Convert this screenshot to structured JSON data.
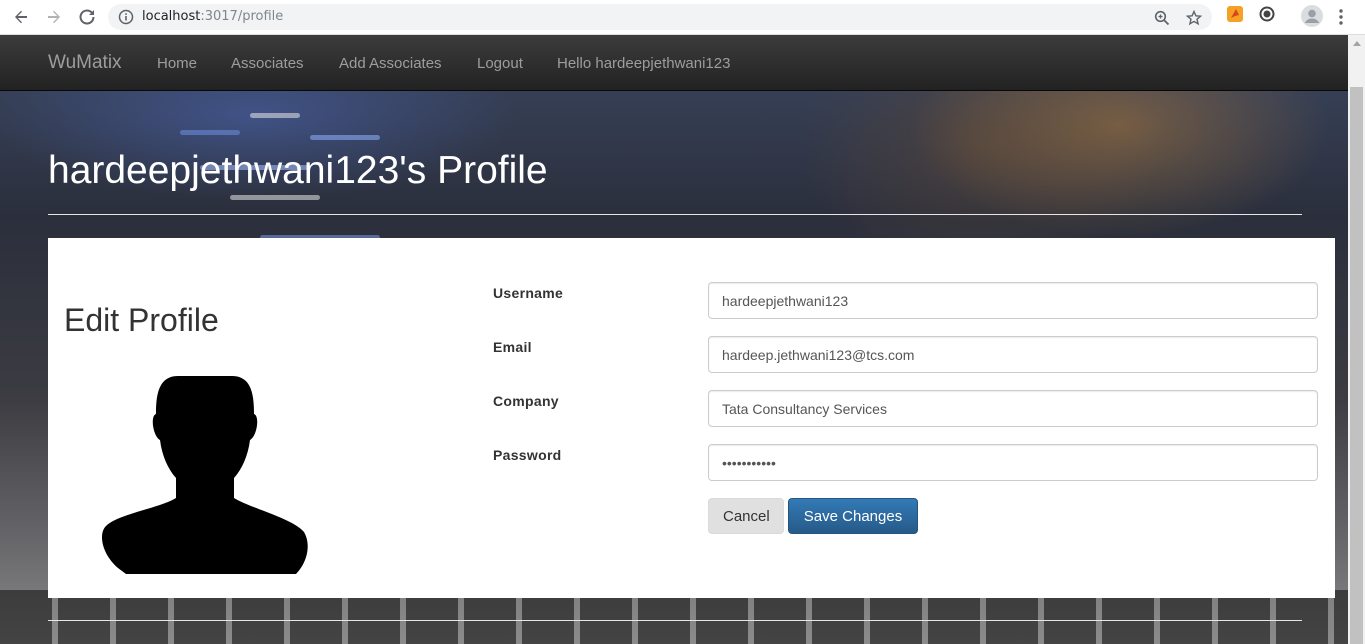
{
  "browser": {
    "url_host": "localhost",
    "url_path": ":3017/profile"
  },
  "navbar": {
    "brand": "WuMatix",
    "links": [
      "Home",
      "Associates",
      "Add Associates",
      "Logout",
      "Hello hardeepjethwani123"
    ]
  },
  "header": {
    "title": "hardeepjethwani123's Profile"
  },
  "profile": {
    "heading": "Edit Profile",
    "fields": [
      {
        "label": "Username",
        "value": "hardeepjethwani123"
      },
      {
        "label": "Email",
        "value": "hardeep.jethwani123@tcs.com"
      },
      {
        "label": "Company",
        "value": "Tata Consultancy Services"
      },
      {
        "label": "Password",
        "value": "•••••••••••"
      }
    ],
    "cancel_label": "Cancel",
    "save_label": "Save Changes"
  },
  "colors": {
    "navbar_bg": "#222222",
    "primary_button": "#337ab7",
    "card_bg": "#ffffff"
  }
}
